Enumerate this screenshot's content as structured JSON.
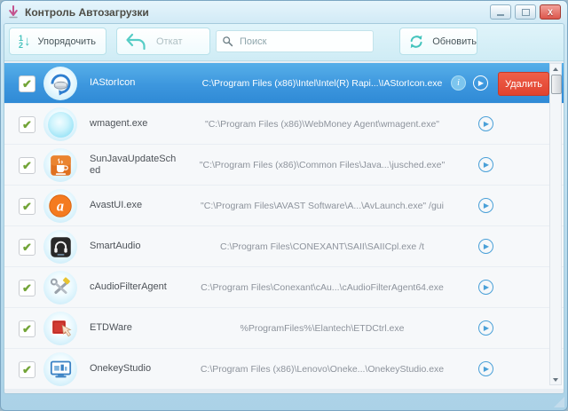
{
  "window": {
    "title": "Контроль Автозагрузки"
  },
  "window_controls": {
    "close_glyph": "X"
  },
  "toolbar": {
    "sort_label": "Упорядочить",
    "undo_label": "Откат",
    "search_placeholder": "Поиск",
    "refresh_label": "Обновить"
  },
  "rows": [
    {
      "name": "IAStorIcon",
      "path": "C:\\Program Files (x86)\\Intel\\Intel(R) Rapi...\\IAStorIcon.exe",
      "selected": true,
      "delete_label": "Удалить"
    },
    {
      "name": "wmagent.exe",
      "path": "\"C:\\Program Files (x86)\\WebMoney Agent\\wmagent.exe\""
    },
    {
      "name": "SunJavaUpdateSched",
      "path": "\"C:\\Program Files (x86)\\Common Files\\Java...\\jusched.exe\""
    },
    {
      "name": "AvastUI.exe",
      "path": "\"C:\\Program Files\\AVAST Software\\A...\\AvLaunch.exe\" /gui"
    },
    {
      "name": "SmartAudio",
      "path": "C:\\Program Files\\CONEXANT\\SAII\\SAIICpl.exe /t"
    },
    {
      "name": "cAudioFilterAgent",
      "path": "C:\\Program Files\\Conexant\\cAu...\\cAudioFilterAgent64.exe"
    },
    {
      "name": "ETDWare",
      "path": "%ProgramFiles%\\Elantech\\ETDCtrl.exe"
    },
    {
      "name": "OnekeyStudio",
      "path": "C:\\Program Files (x86)\\Lenovo\\Oneke...\\OnekeyStudio.exe"
    }
  ],
  "icons": {
    "check": "✔",
    "play": "▶",
    "info": "i",
    "sort_1": "1",
    "sort_2": "2",
    "sort_arrow": "↓"
  },
  "colors": {
    "selected_row_blue": "#3d97de",
    "accent_teal": "#45c4bd",
    "delete_red": "#e8513c",
    "check_green": "#72a437",
    "close_red": "#dc564c"
  }
}
